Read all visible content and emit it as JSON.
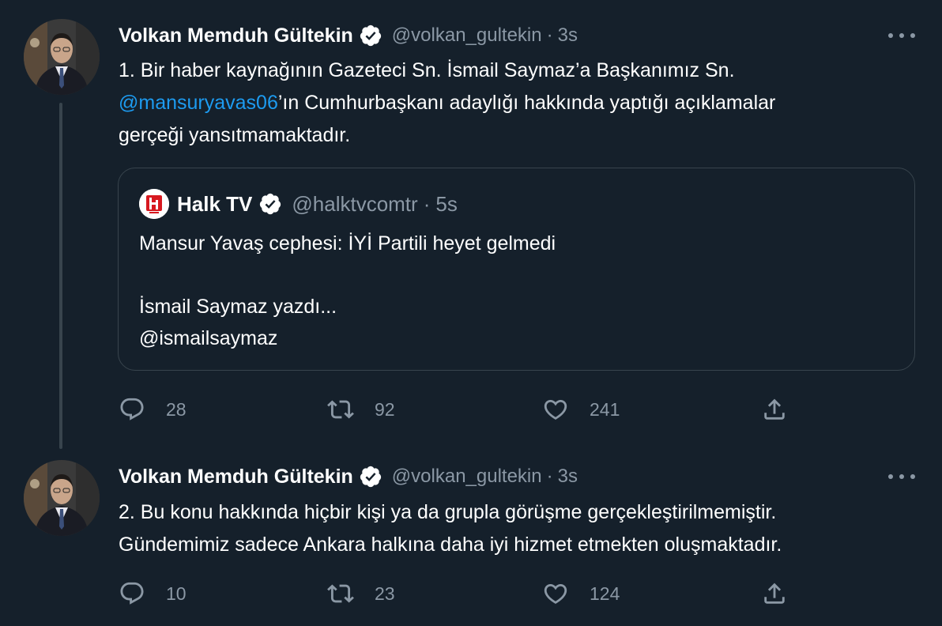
{
  "colors": {
    "background": "#15202b",
    "text": "#ffffff",
    "secondary": "#8b98a5",
    "accent": "#1d9bf0",
    "border": "#38444d"
  },
  "tweets": [
    {
      "author": {
        "name": "Volkan Memduh Gültekin",
        "handle": "@volkan_gultekin",
        "verified": true
      },
      "separator": "·",
      "time": "3s",
      "text": {
        "line1": "1. Bir haber kaynağının Gazeteci Sn. İsmail Saymaz’a Başkanımız Sn.",
        "mention": "@mansuryavas06",
        "line2_rest": "’ın Cumhurbaşkanı adaylığı hakkında yaptığı açıklamalar",
        "line3": "gerçeği yansıtmamaktadır."
      },
      "quote": {
        "name": "Halk TV",
        "handle": "@halktvcomtr",
        "separator": "·",
        "time": "5s",
        "lines": [
          "Mansur Yavaş cephesi: İYİ Partili heyet gelmedi",
          "",
          "İsmail Saymaz yazdı...",
          "@ismailsaymaz"
        ]
      },
      "actions": {
        "replies": "28",
        "retweets": "92",
        "likes": "241"
      }
    },
    {
      "author": {
        "name": "Volkan Memduh Gültekin",
        "handle": "@volkan_gultekin",
        "verified": true
      },
      "separator": "·",
      "time": "3s",
      "text": {
        "line1": "2. Bu konu hakkında hiçbir kişi ya da grupla görüşme gerçekleştirilmemiştir.",
        "line2": "Gündemimiz sadece Ankara halkına daha iyi hizmet etmekten oluşmaktadır."
      },
      "actions": {
        "replies": "10",
        "retweets": "23",
        "likes": "124"
      }
    }
  ],
  "icons": {
    "verified": "verified-badge-icon",
    "more": "more-dots-icon",
    "reply": "reply-bubble-icon",
    "retweet": "retweet-arrows-icon",
    "like": "heart-icon",
    "share": "share-upload-icon",
    "quote_logo": "halktv-logo-icon"
  }
}
